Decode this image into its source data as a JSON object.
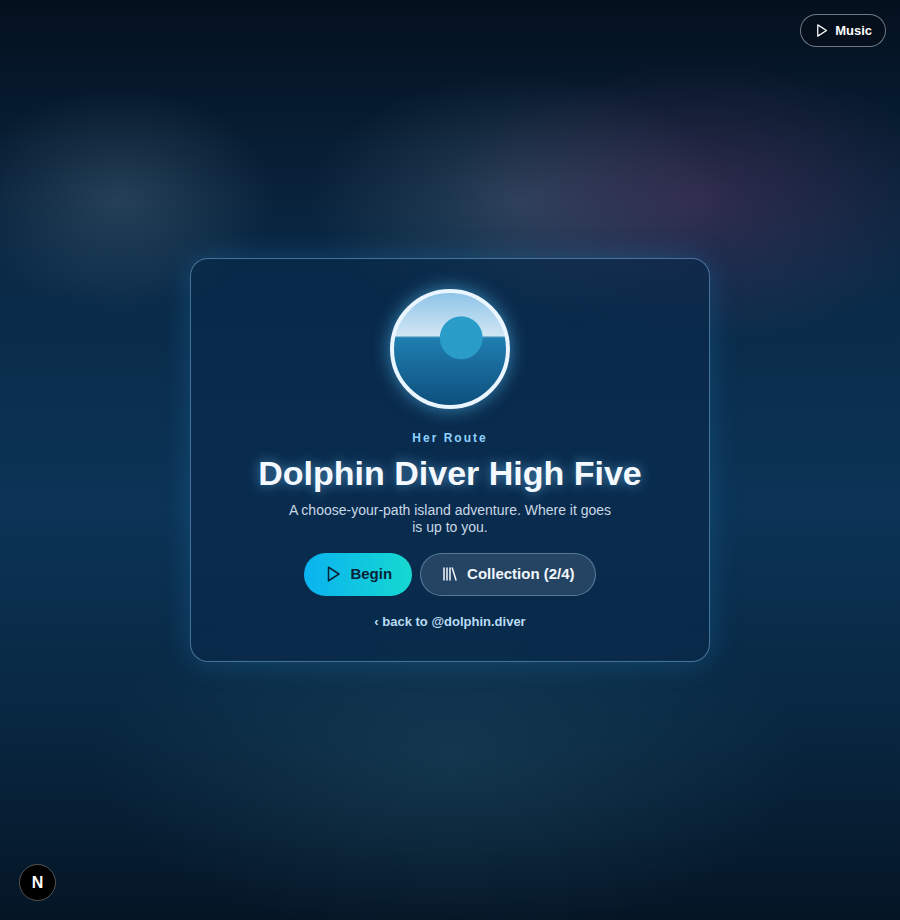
{
  "music_button": {
    "label": "Music"
  },
  "hero": {
    "eyebrow": "Her Route",
    "title": "Dolphin Diver High Five",
    "subtitle": "A choose-your-path island adventure. Where it goes is up to you.",
    "buttons": [
      {
        "label": "Begin",
        "kind": "primary"
      },
      {
        "label": "Collection (2/4)",
        "kind": "secondary"
      }
    ],
    "back_link": "‹ back to @dolphin.diver"
  },
  "dev_badge": "N"
}
